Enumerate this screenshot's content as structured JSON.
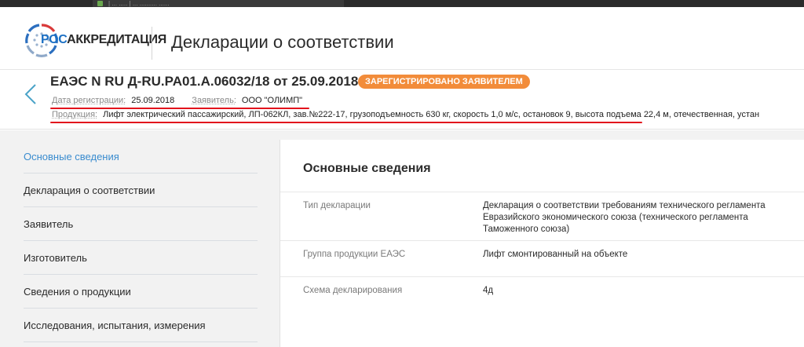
{
  "browser": {
    "tab_fragment": "| ... ..... | ... .......... ......"
  },
  "header": {
    "logo_ros": "РОС",
    "logo_rest": "АККРЕДИТАЦИЯ",
    "app_title": "Декларации о соответствии"
  },
  "declaration": {
    "title": "ЕАЭС N RU Д-RU.PA01.A.06032/18 от 25.09.2018",
    "status": "ЗАРЕГИСТРИРОВАНО ЗАЯВИТЕЛЕМ",
    "reg_date_label": "Дата регистрации:",
    "reg_date_value": "25.09.2018",
    "applicant_label": "Заявитель:",
    "applicant_value": "ООО \"ОЛИМП\"",
    "product_label": "Продукция:",
    "product_value": "Лифт электрический пассажирский, ЛП-062КЛ, зав.№222-17, грузоподъемность 630 кг, скорость 1,0 м/с, остановок 9, высота подъема 22,4 м, отечественная, устан"
  },
  "sidenav": {
    "items": [
      {
        "label": "Основные сведения"
      },
      {
        "label": "Декларация о соответствии"
      },
      {
        "label": "Заявитель"
      },
      {
        "label": "Изготовитель"
      },
      {
        "label": "Сведения о продукции"
      },
      {
        "label": "Исследования, испытания, измерения"
      }
    ]
  },
  "panel": {
    "title": "Основные сведения",
    "rows": [
      {
        "label": "Тип декларации",
        "value": "Декларация о соответствии требованиям технического регламента Евразийского экономического союза (технического регламента Таможенного союза)"
      },
      {
        "label": "Группа продукции ЕАЭС",
        "value": "Лифт смонтированный на объекте"
      },
      {
        "label": "Схема декларирования",
        "value": "4д"
      }
    ]
  },
  "colors": {
    "accent_blue": "#3a8ccf",
    "status_orange": "#f28c3a",
    "annotation_red": "#e2131c",
    "logo_blue": "#1b6fc3"
  }
}
